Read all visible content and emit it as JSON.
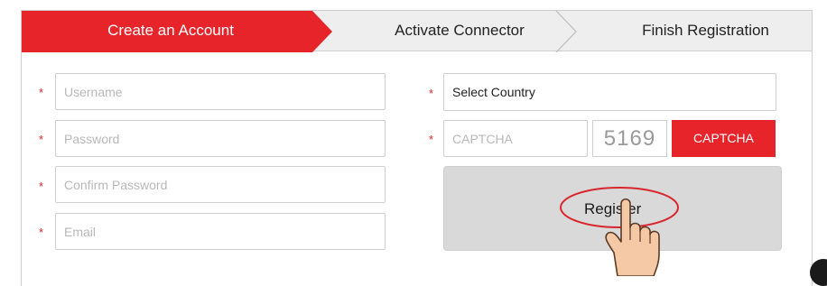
{
  "steps": [
    {
      "label": "Create an Account",
      "state": "active"
    },
    {
      "label": "Activate Connector",
      "state": "inactive"
    },
    {
      "label": "Finish Registration",
      "state": "inactive"
    }
  ],
  "form": {
    "required_mark": "*",
    "username": {
      "placeholder": "Username",
      "value": ""
    },
    "password": {
      "placeholder": "Password",
      "value": ""
    },
    "confirm_password": {
      "placeholder": "Confirm Password",
      "value": ""
    },
    "email": {
      "placeholder": "Email",
      "value": ""
    },
    "country": {
      "selected": "Select Country"
    },
    "captcha": {
      "placeholder": "CAPTCHA",
      "value": "",
      "image_code": "5169",
      "button_label": "CAPTCHA"
    },
    "register_label": "Register"
  },
  "colors": {
    "accent": "#e8242b",
    "step_inactive_bg": "#eeeeee",
    "register_bg": "#d9d9d9",
    "annotation": "#d9252c",
    "hand_fill": "#f6c9a6"
  },
  "icons": [
    "pointing-hand-icon",
    "corner-badge-icon"
  ]
}
